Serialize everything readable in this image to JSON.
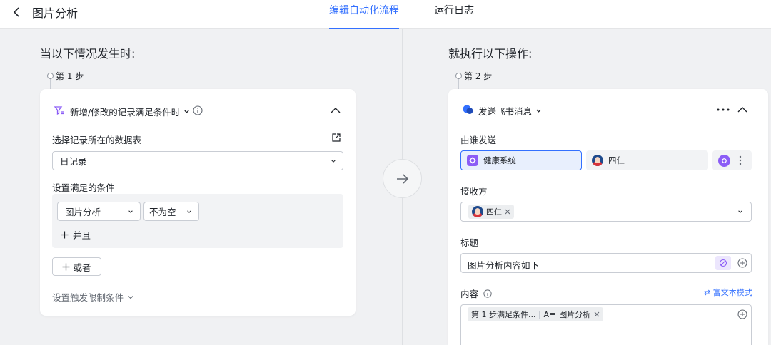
{
  "header": {
    "title": "图片分析",
    "tabs": [
      {
        "label": "编辑自动化流程",
        "active": true
      },
      {
        "label": "运行日志",
        "active": false
      }
    ]
  },
  "trigger": {
    "heading": "当以下情况发生时:",
    "step_label": "第 1 步",
    "type_label": "新增/修改的记录满足条件时",
    "table_label": "选择记录所在的数据表",
    "table_value": "日记录",
    "conditions_label": "设置满足的条件",
    "condition": {
      "field": "图片分析",
      "operator": "不为空"
    },
    "and_label": "并且",
    "or_label": "或者",
    "limit_label": "设置触发限制条件"
  },
  "action": {
    "heading": "就执行以下操作:",
    "step_label": "第 2 步",
    "type_label": "发送飞书消息",
    "sender_label": "由谁发送",
    "sender_options": [
      {
        "label": "健康系统",
        "selected": true
      },
      {
        "label": "四仁",
        "selected": false
      }
    ],
    "recipient_label": "接收方",
    "recipient_tag": "四仁",
    "title_label": "标题",
    "title_value": "图片分析内容如下",
    "content_label": "内容",
    "rich_text_label": "⇄ 富文本模式",
    "content_tags": [
      "第 1 步满足条件...",
      "图片分析"
    ],
    "content_tag_prefix": "A≡"
  },
  "colors": {
    "accent": "#3370ff",
    "trigger_icon": "#8b5cf6",
    "app_icon": "#8b5cf6"
  }
}
